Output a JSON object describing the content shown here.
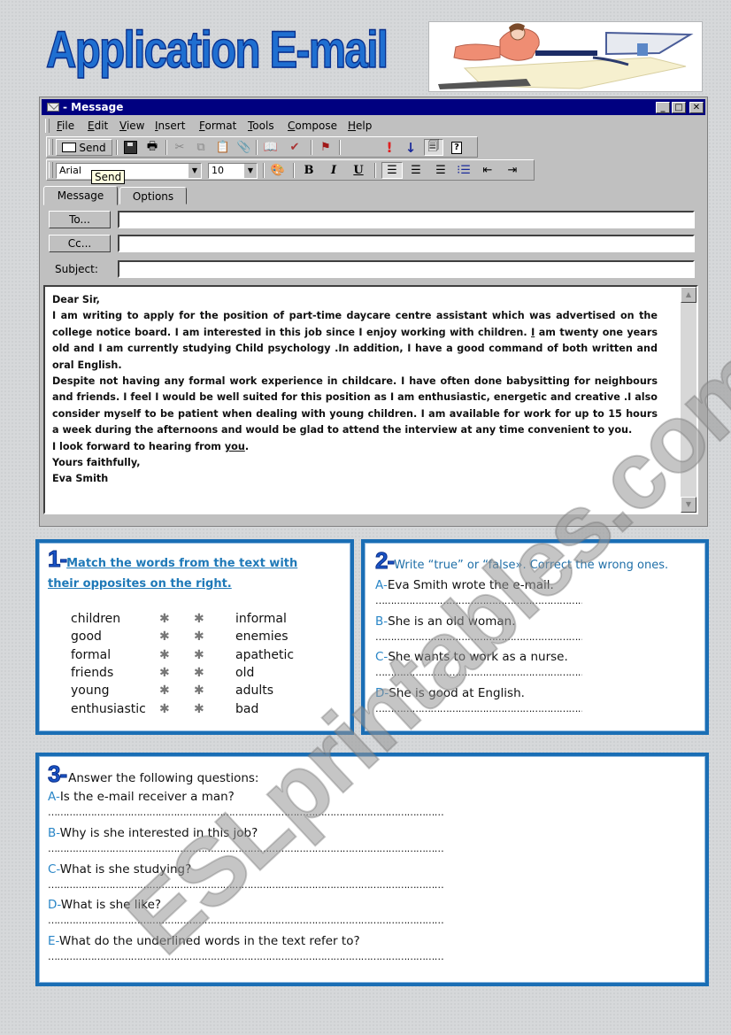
{
  "page": {
    "title": "Application E-mail",
    "clipart_alt": "woman typing at computer",
    "watermark": "ESLprintables.com"
  },
  "window": {
    "title": "- Message",
    "icon": "envelope-icon",
    "controls": [
      "minimize",
      "maximize",
      "close"
    ],
    "menu": [
      {
        "label": "File"
      },
      {
        "label": "Edit"
      },
      {
        "label": "View"
      },
      {
        "label": "Insert"
      },
      {
        "label": "Format"
      },
      {
        "label": "Tools"
      },
      {
        "label": "Compose"
      },
      {
        "label": "Help"
      }
    ],
    "toolbar": {
      "send_label": "Send",
      "icons": [
        "save-icon",
        "print-icon",
        "cut-icon",
        "copy-icon",
        "paste-icon",
        "attach-icon",
        "address-book-icon",
        "check-names-icon",
        "flag-icon",
        "high-priority-icon",
        "low-priority-icon",
        "properties-icon",
        "help-icon"
      ]
    },
    "format_bar": {
      "font": "Arial",
      "size": "10",
      "icons": [
        "color-icon",
        "bold-icon",
        "italic-icon",
        "underline-icon",
        "align-left-icon",
        "align-center-icon",
        "align-right-icon",
        "bullets-icon",
        "decrease-indent-icon",
        "increase-indent-icon"
      ]
    },
    "tooltip": "Send",
    "tabs": [
      {
        "label": "Message",
        "active": true
      },
      {
        "label": "Options",
        "active": false
      }
    ],
    "fields": {
      "to_label": "To...",
      "cc_label": "Cc...",
      "subject_label": "Subject:",
      "to_value": "",
      "cc_value": "",
      "subject_value": ""
    },
    "letter": {
      "greeting": "Dear Sir,",
      "p1_a": "I am writing to apply for the position of part-time daycare centre assistant which was advertised on the college notice board. I am interested in this job since I enjoy working with children. ",
      "p1_u": "I",
      "p1_b": " am twenty one years old and I am currently studying Child psychology .In addition, I have a good command of both written and oral English.",
      "p2": "Despite not having any formal work experience in childcare. I have often done babysitting for neighbours and friends. I feel I would be well suited for this position as I am enthusiastic, energetic and creative .I also consider myself to be patient when dealing with young children. I am available for work for up to 15 hours a week during the afternoons and would be glad to attend the interview at any time convenient to you.",
      "p3_a": "I look forward to hearing from ",
      "p3_u": "you",
      "p3_b": ".",
      "closing": "Yours faithfully,",
      "signature": "Eva Smith"
    }
  },
  "exercise1": {
    "number": "1-",
    "instruction": "Match the words from the text with their opposites on the right.",
    "pairs": [
      {
        "word": "children",
        "opposite": "informal"
      },
      {
        "word": "good",
        "opposite": "enemies"
      },
      {
        "word": "formal",
        "opposite": "apathetic"
      },
      {
        "word": "friends",
        "opposite": "old"
      },
      {
        "word": "young",
        "opposite": "adults"
      },
      {
        "word": "enthusiastic",
        "opposite": "bad"
      }
    ],
    "star": "✱"
  },
  "exercise2": {
    "number": "2-",
    "instruction": "Write “true” or “false». Correct the wrong ones.",
    "items": [
      {
        "letter": "A-",
        "text": "Eva Smith wrote the e-mail."
      },
      {
        "letter": "B-",
        "text": "She is an old woman."
      },
      {
        "letter": "C-",
        "text": "She wants to work as a nurse."
      },
      {
        "letter": "D-",
        "text": "She is good at English."
      }
    ],
    "answer_line": "……………………………………………………………"
  },
  "exercise3": {
    "number": "3-",
    "instruction": "Answer the following questions:",
    "items": [
      {
        "letter": "A-",
        "text": "Is the e-mail receiver a man?"
      },
      {
        "letter": "B-",
        "text": "Why is she interested in this job?"
      },
      {
        "letter": "C-",
        "text": "What is she studying?"
      },
      {
        "letter": "D-",
        "text": "What is she like?"
      },
      {
        "letter": "E-",
        "text": "What do the underlined words in the text refer to?"
      }
    ],
    "answer_line": "…………………………………………………………………………………………………………………"
  }
}
